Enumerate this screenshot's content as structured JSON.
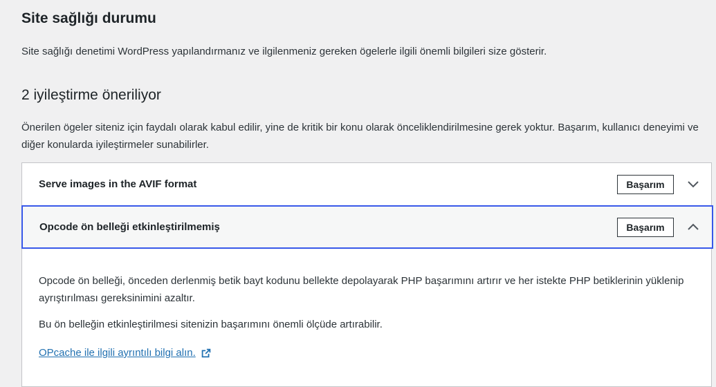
{
  "page": {
    "title": "Site sağlığı durumu",
    "description": "Site sağlığı denetimi WordPress yapılandırmanız ve ilgilenmeniz gereken ögelerle ilgili önemli bilgileri size gösterir."
  },
  "section": {
    "title": "2 iyileştirme öneriliyor",
    "description": "Önerilen ögeler siteniz için faydalı olarak kabul edilir, yine de kritik bir konu olarak önceliklendirilmesine gerek yoktur. Başarım, kullanıcı deneyimi ve diğer konularda iyileştirmeler sunabilirler."
  },
  "items": [
    {
      "title": "Serve images in the AVIF format",
      "badge": "Başarım",
      "expanded": false,
      "icon": "chevron-down-icon"
    },
    {
      "title": "Opcode ön belleği etkinleştirilmemiş",
      "badge": "Başarım",
      "expanded": true,
      "icon": "chevron-up-icon",
      "body": {
        "paragraph1": "Opcode ön belleği, önceden derlenmiş betik bayt kodunu bellekte depolayarak PHP başarımını artırır ve her istekte PHP betiklerinin yüklenip ayrıştırılması gereksinimini azaltır.",
        "paragraph2": "Bu ön belleğin etkinleştirilmesi sitenizin başarımını önemli ölçüde artırabilir.",
        "link_text": "OPcache ile ilgili ayrıntılı bilgi alın.",
        "link_icon": "external-link-icon"
      }
    }
  ],
  "colors": {
    "background": "#f0f0f1",
    "accent": "#3858e9",
    "link": "#2271b1",
    "text": "#1d2327"
  }
}
